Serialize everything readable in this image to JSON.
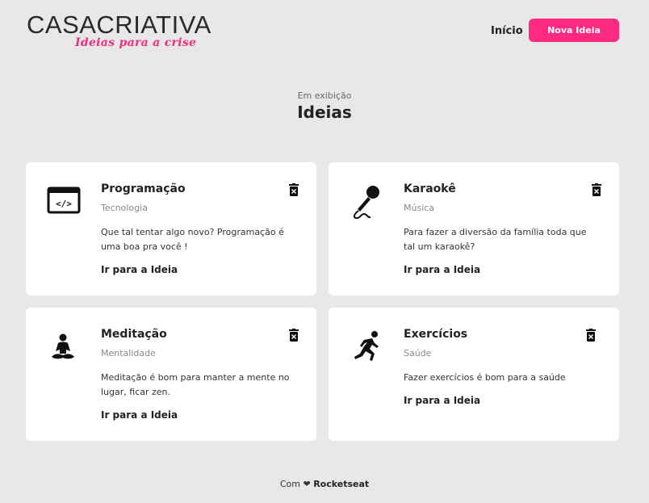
{
  "brand": {
    "name_bold": "CASA",
    "name_light": "CRIATIVA",
    "tagline": "Ideias para a crise"
  },
  "nav": {
    "home_label": "Início",
    "new_idea_label": "Nova Ideia"
  },
  "section": {
    "subtitle": "Em exibição",
    "title": "Ideias"
  },
  "cards": [
    {
      "title": "Programação",
      "category": "Tecnologia",
      "description": "Que tal tentar algo novo? Programação é uma boa pra você !",
      "link": "Ir para a Ideia",
      "icon": "code-window-icon"
    },
    {
      "title": "Karaokê",
      "category": "Música",
      "description": "Para fazer a diversão da família toda que tal um karaokê?",
      "link": "Ir para a Ideia",
      "icon": "microphone-icon"
    },
    {
      "title": "Meditação",
      "category": "Mentalidade",
      "description": "Meditação é bom para manter a mente no lugar, ficar zen.",
      "link": "Ir para a Ideia",
      "icon": "meditation-icon"
    },
    {
      "title": "Exercícios",
      "category": "Saúde",
      "description": "Fazer exercícios é bom para a saúde",
      "link": "Ir para a Ideia",
      "icon": "running-icon"
    }
  ],
  "footer": {
    "prefix": "Com",
    "heart": "❤",
    "brand": "Rocketseat"
  },
  "colors": {
    "accent": "#fe2a7f",
    "background": "#e8e8e8",
    "card": "#ffffff"
  }
}
